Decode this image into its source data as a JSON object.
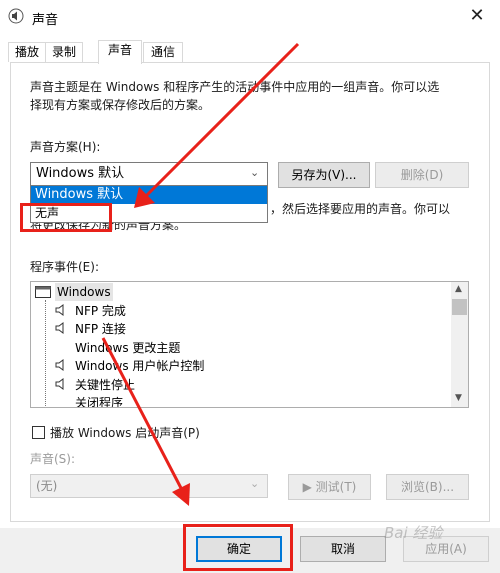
{
  "window": {
    "title": "声音",
    "close_glyph": "✕"
  },
  "tabs": [
    {
      "label": "播放"
    },
    {
      "label": "录制"
    },
    {
      "label": "声音"
    },
    {
      "label": "通信"
    }
  ],
  "description": {
    "line1": "声音主题是在 Windows 和程序产生的活动事件中应用的一组声音。你可以选",
    "line2": "择现有方案或保存修改后的方案。"
  },
  "scheme": {
    "label": "声音方案(H):",
    "selected": "Windows 默认",
    "options": [
      "Windows 默认",
      "无声"
    ],
    "save_as": "另存为(V)...",
    "delete": "删除(D)"
  },
  "hint": {
    "line1_tail": "，然后选择要应用的声音。你可以",
    "line2": "将更改保存为新的声音方案。"
  },
  "events": {
    "label": "程序事件(E):",
    "items": [
      "Windows",
      "NFP 完成",
      "NFP 连接",
      "Windows 更改主题",
      "Windows 用户帐户控制",
      "关键性停止",
      "关闭程序"
    ]
  },
  "startup": {
    "label": "播放 Windows 启动声音(P)"
  },
  "sound": {
    "label": "声音(S):",
    "value": "(无)",
    "test": "▶ 测试(T)",
    "browse": "浏览(B)..."
  },
  "footer": {
    "ok": "确定",
    "cancel": "取消",
    "apply": "应用(A)"
  },
  "watermark": "Bai 经验",
  "colors": {
    "annotation": "#e8211a",
    "selection": "#0078d7"
  }
}
